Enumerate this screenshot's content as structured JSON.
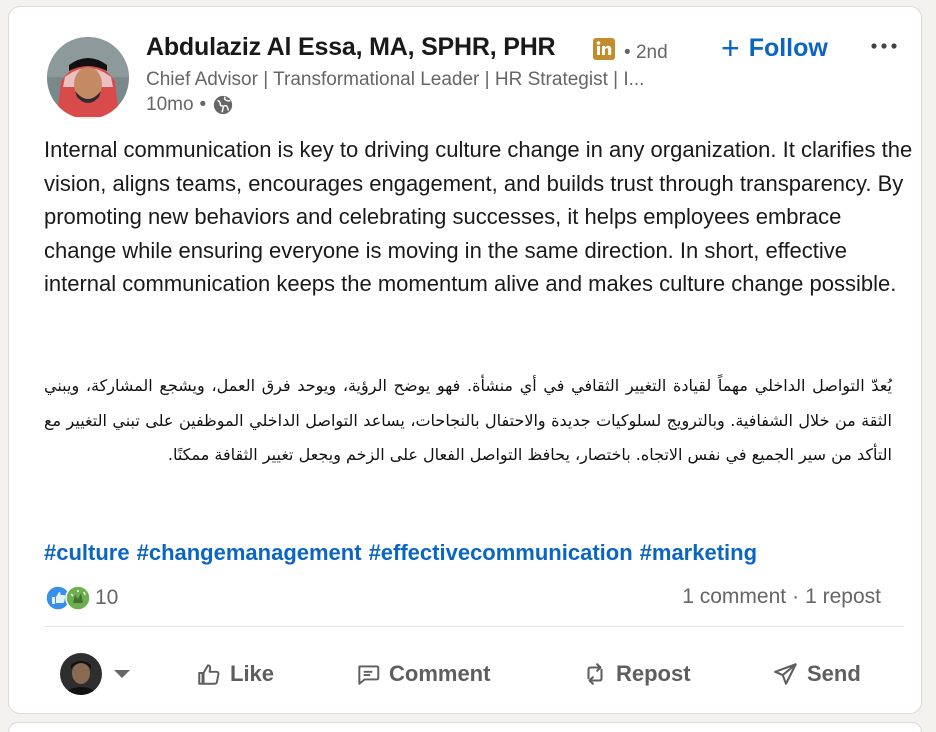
{
  "author": {
    "name": "Abdulaziz Al Essa, MA, SPHR, PHR",
    "degree": "2nd",
    "headline": "Chief Advisor | Transformational Leader | HR Strategist | I...",
    "time": "10mo",
    "visibility_icon": "globe-icon",
    "badge_icon": "linkedin-premium-icon"
  },
  "header": {
    "follow_label": "Follow",
    "more_icon": "more-horizontal-icon"
  },
  "post": {
    "english": "Internal communication is key to driving culture change in any organization. It clarifies the vision, aligns teams, encourages engagement, and builds trust through transparency. By promoting new behaviors and celebrating successes, it helps employees embrace change while ensuring everyone is moving in the same direction. In short, effective internal communication keeps the momentum alive and makes culture change possible.",
    "arabic": "يُعدّ التواصل الداخلي مهماً لقيادة التغيير الثقافي في أي منشأة. فهو يوضح الرؤية، ويوحد فرق العمل، ويشجع المشاركة، ويبني الثقة من خلال الشفافية. وبالترويج لسلوكيات جديدة والاحتفال بالنجاحات، يساعد التواصل الداخلي الموظفين على تبني التغيير مع التأكد من سير الجميع في نفس الاتجاه. باختصار، يحافظ التواصل الفعال على الزخم ويجعل تغيير الثقافة ممكنًا.",
    "hashtags": [
      "#culture",
      "#changemanagement",
      "#effectivecommunication",
      "#marketing"
    ]
  },
  "engagement": {
    "reaction_icons": [
      "like-reaction-icon",
      "celebrate-reaction-icon"
    ],
    "reaction_count": "10",
    "comments": "1 comment",
    "reposts": "1 repost",
    "separator": "·"
  },
  "actions": {
    "like": "Like",
    "comment": "Comment",
    "repost": "Repost",
    "send": "Send"
  },
  "colors": {
    "accent": "#0a66c2",
    "muted_text": "#666666",
    "premium_gold": "#c38d2e",
    "like_blue": "#378fe9",
    "celebrate_green": "#44712e"
  }
}
